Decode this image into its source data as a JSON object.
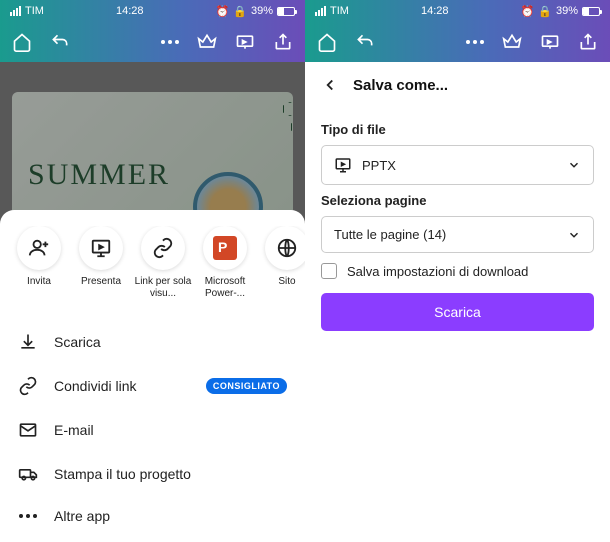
{
  "status": {
    "carrier": "TIM",
    "time": "14:28",
    "battery_pct": "39%"
  },
  "canvas": {
    "title": "SUMMER"
  },
  "share_row": {
    "items": [
      {
        "label": "Invita"
      },
      {
        "label": "Presenta"
      },
      {
        "label": "Link per sola visu..."
      },
      {
        "label": "Microsoft Power-..."
      },
      {
        "label": "Sito"
      }
    ]
  },
  "actions": {
    "download": "Scarica",
    "share_link": "Condividi link",
    "share_badge": "CONSIGLIATO",
    "email": "E-mail",
    "print": "Stampa il tuo progetto",
    "more": "Altre app"
  },
  "save_as": {
    "header": "Salva come...",
    "filetype_label": "Tipo di file",
    "filetype_value": "PPTX",
    "pages_label": "Seleziona pagine",
    "pages_value": "Tutte le pagine (14)",
    "save_settings": "Salva impostazioni di download",
    "download_btn": "Scarica"
  }
}
